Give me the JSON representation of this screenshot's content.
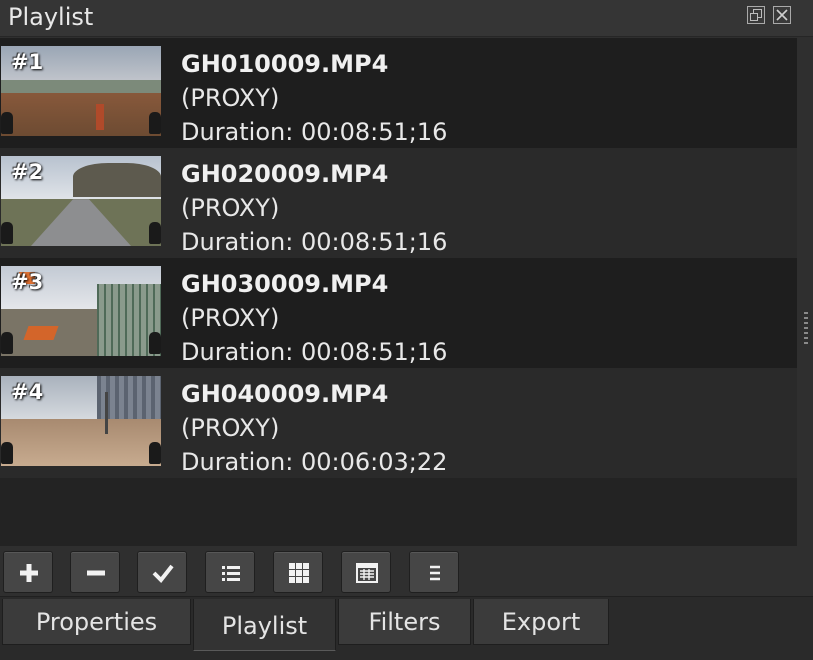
{
  "panel": {
    "title": "Playlist"
  },
  "playlist": {
    "items": [
      {
        "number": "#1",
        "filename": "GH010009.MP4",
        "tag": "(PROXY)",
        "duration": "Duration: 00:08:51;16"
      },
      {
        "number": "#2",
        "filename": "GH020009.MP4",
        "tag": "(PROXY)",
        "duration": "Duration: 00:08:51;16"
      },
      {
        "number": "#3",
        "filename": "GH030009.MP4",
        "tag": "(PROXY)",
        "duration": "Duration: 00:08:51;16"
      },
      {
        "number": "#4",
        "filename": "GH040009.MP4",
        "tag": "(PROXY)",
        "duration": "Duration: 00:06:03;22"
      }
    ]
  },
  "toolbar": {
    "buttons": [
      {
        "icon": "plus-icon"
      },
      {
        "icon": "minus-icon"
      },
      {
        "icon": "check-icon"
      },
      {
        "icon": "details-view-icon"
      },
      {
        "icon": "tiles-view-icon"
      },
      {
        "icon": "icon-view-icon"
      },
      {
        "icon": "menu-icon"
      }
    ]
  },
  "tabs": {
    "items": [
      {
        "label": "Properties"
      },
      {
        "label": "Playlist"
      },
      {
        "label": "Filters"
      },
      {
        "label": "Export"
      }
    ],
    "active": "Playlist"
  },
  "colors": {
    "background": "#2f2f2f",
    "row_dark": "#1e1e1e",
    "row_light": "#2a2a2a",
    "text": "#e8e8e8"
  }
}
